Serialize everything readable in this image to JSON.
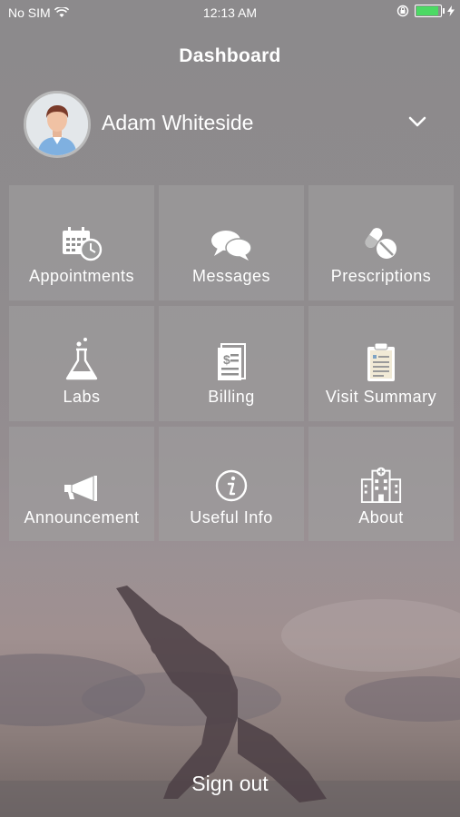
{
  "status_bar": {
    "carrier": "No SIM",
    "time": "12:13 AM",
    "battery_color": "#4cd964"
  },
  "header": {
    "title": "Dashboard"
  },
  "profile": {
    "name": "Adam Whiteside",
    "avatar_icon": "user-avatar",
    "expand_icon": "chevron-down-icon"
  },
  "menu": {
    "items": [
      {
        "label": "Appointments",
        "icon": "calendar-clock-icon"
      },
      {
        "label": "Messages",
        "icon": "chat-bubbles-icon"
      },
      {
        "label": "Prescriptions",
        "icon": "pills-icon"
      },
      {
        "label": "Labs",
        "icon": "flask-icon"
      },
      {
        "label": "Billing",
        "icon": "bill-icon"
      },
      {
        "label": "Visit Summary",
        "icon": "clipboard-icon"
      },
      {
        "label": "Announcement",
        "icon": "megaphone-icon"
      },
      {
        "label": "Useful Info",
        "icon": "info-icon"
      },
      {
        "label": "About",
        "icon": "hospital-icon"
      }
    ]
  },
  "footer": {
    "signout_label": "Sign out"
  }
}
